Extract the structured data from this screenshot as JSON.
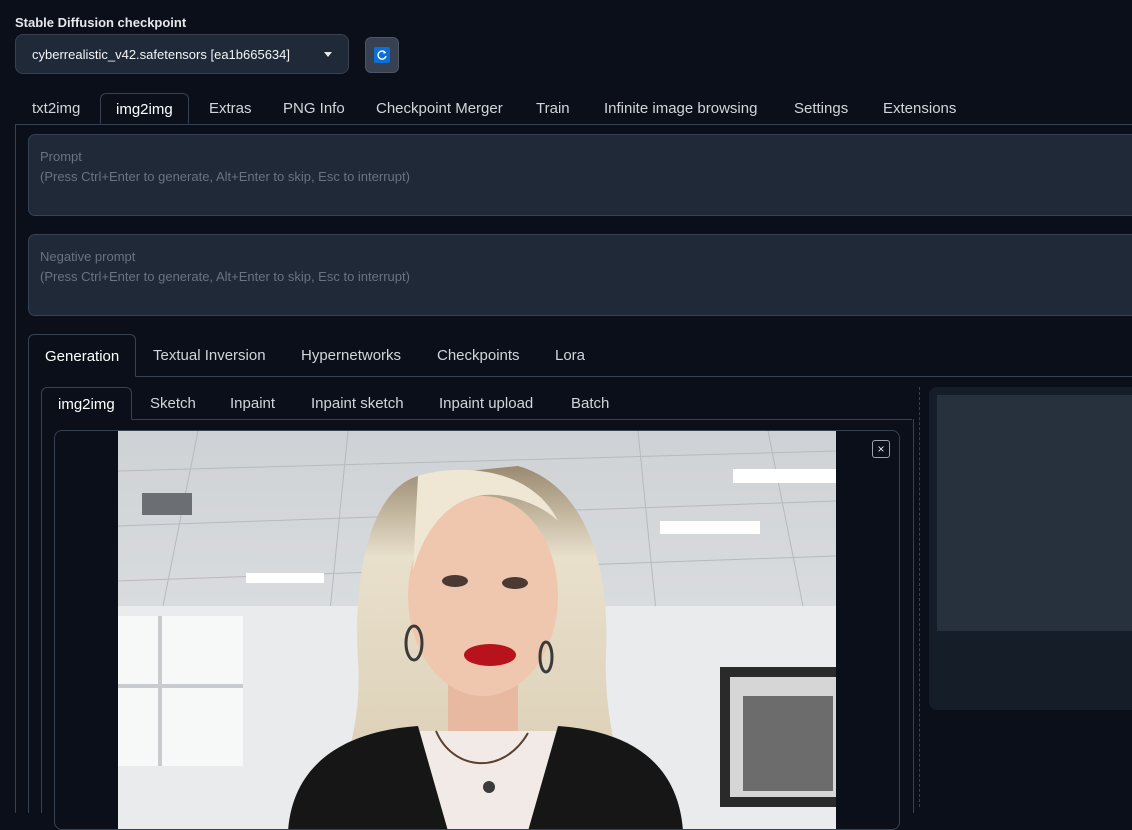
{
  "checkpoint": {
    "label": "Stable Diffusion checkpoint",
    "value": "cyberrealistic_v42.safetensors [ea1b665634]"
  },
  "main_tabs": [
    {
      "label": "txt2img",
      "active": false
    },
    {
      "label": "img2img",
      "active": true
    },
    {
      "label": "Extras",
      "active": false
    },
    {
      "label": "PNG Info",
      "active": false
    },
    {
      "label": "Checkpoint Merger",
      "active": false
    },
    {
      "label": "Train",
      "active": false
    },
    {
      "label": "Infinite image browsing",
      "active": false
    },
    {
      "label": "Settings",
      "active": false
    },
    {
      "label": "Extensions",
      "active": false
    }
  ],
  "prompt": {
    "label": "Prompt",
    "placeholder": "(Press Ctrl+Enter to generate, Alt+Enter to skip, Esc to interrupt)"
  },
  "negative_prompt": {
    "label": "Negative prompt",
    "placeholder": "(Press Ctrl+Enter to generate, Alt+Enter to skip, Esc to interrupt)"
  },
  "sub_tabs": [
    {
      "label": "Generation",
      "active": true
    },
    {
      "label": "Textual Inversion",
      "active": false
    },
    {
      "label": "Hypernetworks",
      "active": false
    },
    {
      "label": "Checkpoints",
      "active": false
    },
    {
      "label": "Lora",
      "active": false
    }
  ],
  "img2img_tabs": [
    {
      "label": "img2img",
      "active": true
    },
    {
      "label": "Sketch",
      "active": false
    },
    {
      "label": "Inpaint",
      "active": false
    },
    {
      "label": "Inpaint sketch",
      "active": false
    },
    {
      "label": "Inpaint upload",
      "active": false
    },
    {
      "label": "Batch",
      "active": false
    }
  ],
  "image_close_symbol": "×",
  "colors": {
    "background": "#0b0f19",
    "panel": "#1f2937",
    "border": "#374151",
    "accent": "#0b6fd8"
  }
}
